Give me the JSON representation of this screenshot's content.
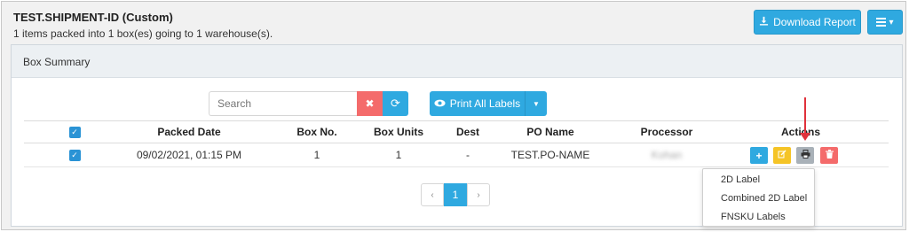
{
  "header": {
    "title": "TEST.SHIPMENT-ID (Custom)",
    "subtitle": "1 items packed into 1 box(es) going to 1 warehouse(s).",
    "download_label": "Download Report"
  },
  "panel": {
    "title": "Box Summary"
  },
  "toolbar": {
    "search_placeholder": "Search",
    "clear_glyph": "✖",
    "refresh_glyph": "⟳",
    "print_all_label": "Print All Labels"
  },
  "table": {
    "columns": [
      "Packed Date",
      "Box No.",
      "Box Units",
      "Dest",
      "PO Name",
      "Processor",
      "Actions"
    ],
    "rows": [
      {
        "checked": true,
        "packed_date": "09/02/2021, 01:15 PM",
        "box_no": "1",
        "box_units": "1",
        "dest": "-",
        "po_name": "TEST.PO-NAME",
        "processor": "Kohan"
      }
    ]
  },
  "pagination": {
    "prev": "‹",
    "current": "1",
    "next": "›"
  },
  "print_menu": {
    "items": [
      "2D Label",
      "Combined 2D Label",
      "FNSKU Labels"
    ]
  },
  "colors": {
    "primary": "#2fa9e0",
    "danger": "#f46b6b",
    "warning": "#f5c426",
    "muted": "#a9b1b8",
    "annotation_arrow": "#e0313b"
  }
}
